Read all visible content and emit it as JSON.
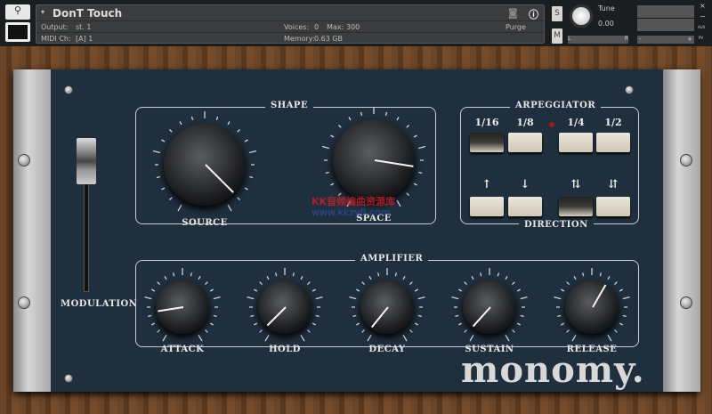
{
  "header": {
    "instrument_name": "DonT Touch",
    "output_label": "Output:",
    "output_value": "st. 1",
    "midi_label": "MIDI Ch:",
    "midi_value": "[A] 1",
    "voices_label": "Voices:",
    "voices_value": "0",
    "max_label": "Max:",
    "max_value": "300",
    "memory_label": "Memory:",
    "memory_value": "0.63 GB",
    "purge_label": "Purge",
    "solo_label": "S",
    "mute_label": "M",
    "tune_label": "Tune",
    "tune_value": "0.00",
    "pan_left": "L",
    "pan_right": "R",
    "vol_minus": "-",
    "vol_plus": "+",
    "close": "×",
    "minimize": "−",
    "aux": "AUX",
    "pv": "PV"
  },
  "shape": {
    "title": "SHAPE",
    "knobs": [
      {
        "label": "SOURCE",
        "value": 0.95
      },
      {
        "label": "SPACE",
        "value": 0.83
      }
    ]
  },
  "arpeggiator": {
    "title": "ARPEGGIATOR",
    "rates": [
      {
        "label": "1/16",
        "active": true
      },
      {
        "label": "1/8",
        "active": false
      },
      {
        "label": "1/4",
        "active": false
      },
      {
        "label": "1/2",
        "active": false
      }
    ],
    "direction_title": "DIRECTION",
    "directions": [
      {
        "label": "↑",
        "active": false
      },
      {
        "label": "↓",
        "active": false
      },
      {
        "label": "⇅",
        "active": true
      },
      {
        "label": "⇵",
        "active": false
      }
    ],
    "led_color": "#a01818"
  },
  "modulation": {
    "label": "MODULATION",
    "value": 0.85
  },
  "amplifier": {
    "title": "AMPLIFIER",
    "knobs": [
      {
        "label": "ATTACK",
        "value": 0.17
      },
      {
        "label": "HOLD",
        "value": 0.05
      },
      {
        "label": "DECAY",
        "value": 0.03
      },
      {
        "label": "SUSTAIN",
        "value": 0.04
      },
      {
        "label": "RELEASE",
        "value": 0.6
      }
    ]
  },
  "brand": {
    "logo": "monomy."
  },
  "watermark": {
    "line1": "KK音频编曲资源库",
    "line2": "www.kkzy8.com"
  },
  "colors": {
    "panel": "#1f2f3d",
    "accent_text": "#e6e6e6"
  }
}
